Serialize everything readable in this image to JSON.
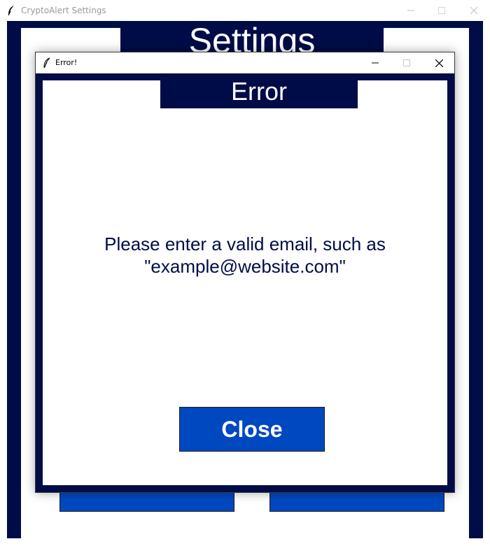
{
  "main_window": {
    "title": "CryptoAlert Settings",
    "header": "Settings",
    "controls": {
      "minimize": "minimize-icon",
      "maximize": "maximize-icon",
      "close": "close-icon"
    }
  },
  "dialog": {
    "title": "Error!",
    "heading": "Error",
    "message_line1": "Please enter a valid email, such as",
    "message_line2": "\"example@website.com\"",
    "close_button": "Close",
    "controls": {
      "minimize": "minimize-icon",
      "maximize": "maximize-icon",
      "close": "close-icon"
    }
  },
  "colors": {
    "navy": "#000c47",
    "button_blue": "#0048c0",
    "white": "#ffffff"
  }
}
